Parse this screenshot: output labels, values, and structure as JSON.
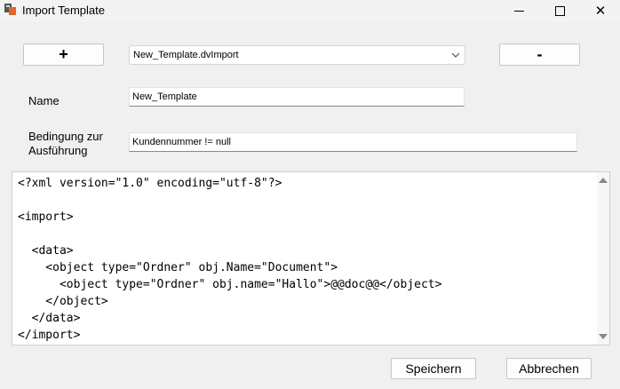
{
  "window": {
    "title": "Import Template",
    "icon": "app-icon",
    "controls": [
      "minimize-icon",
      "maximize-icon",
      "close-icon"
    ]
  },
  "toolbar": {
    "add_label": "+",
    "remove_label": "-",
    "template_selected": "New_Template.dvImport"
  },
  "form": {
    "name_label": "Name",
    "name_value": "New_Template",
    "condition_label": "Bedingung zur Ausführung",
    "condition_value": "Kundennummer != null"
  },
  "editor": {
    "code": "<?xml version=\"1.0\" encoding=\"utf-8\"?>\n\n<import>\n\n  <data>\n    <object type=\"Ordner\" obj.Name=\"Document\">\n      <object type=\"Ordner\" obj.name=\"Hallo\">@@doc@@</object>\n    </object>\n  </data>\n</import>"
  },
  "footer": {
    "save_label": "Speichern",
    "cancel_label": "Abbrechen"
  }
}
